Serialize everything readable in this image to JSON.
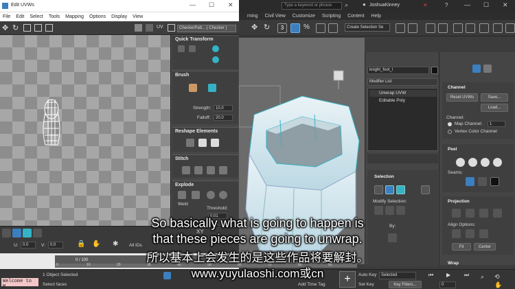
{
  "uvw_window": {
    "title": "Edit UVWs",
    "menu": [
      "File",
      "Edit",
      "Select",
      "Tools",
      "Mapping",
      "Options",
      "Display",
      "View"
    ],
    "uv_label": "UV",
    "checker_dropdown": "CheckerPatt... ( Checker )",
    "sections": {
      "quick_transform": "Quick Transform",
      "brush": "Brush",
      "reshape": "Reshape Elements",
      "stitch": "Stitch",
      "explode": "Explode"
    },
    "strength_label": "Strength:",
    "strength_value": "10.0",
    "falloff_label": "Falloff:",
    "falloff_value": "20.0",
    "weld_label": "Weld",
    "threshold_label": "Threshold:",
    "threshold_value": "0.01",
    "u_label": "U:",
    "u_value": "0.0",
    "v_label": "V:",
    "v_value": "0.0",
    "all_ids": "All IDs",
    "xy_label": "XY"
  },
  "max_window": {
    "search_placeholder": "Type a keyword or phrase",
    "user": "JoshuaKinney",
    "menu": [
      "rning",
      "Civil View",
      "Customize",
      "Scripting",
      "Content",
      "Help"
    ],
    "create_selection_set": "Create Selection Se",
    "object_name": "knight_foot_l",
    "modifier_list": "Modifier List",
    "stack": [
      "Unwrap UVW",
      "Editable Poly"
    ],
    "channel_header": "Channel",
    "reset_uvws": "Reset UVWs",
    "save": "Save...",
    "load": "Load...",
    "channel_label": "Channel:",
    "map_channel_label": "Map Channel:",
    "map_channel_value": "1",
    "vertex_color_channel": "Vertex Color Channel",
    "peel_header": "Peel",
    "seams_label": "Seams:",
    "selection_header": "Selection",
    "modify_selection": "Modify Selection:",
    "by_label": "By:",
    "projection_header": "Projection",
    "align_options": "Align Options:",
    "fit": "Fit",
    "center": "Center",
    "wrap_header": "Wrap"
  },
  "status": {
    "maxscript": "Welcome to M",
    "objects_selected": "1 Object Selected",
    "prompt": "Select faces",
    "add_time_tag": "Add Time Tag",
    "auto_key": "Auto Key",
    "set_key": "Set Key",
    "selected": "Selected",
    "key_filters": "Key Filters...",
    "frame_count": "0 / 100",
    "frame_value": "0"
  },
  "timeline_ticks": [
    "0",
    "10",
    "20",
    "30",
    "40",
    "50",
    "60",
    "70",
    "80",
    "90"
  ],
  "subtitles": {
    "line1": "So basically what is going to happen is",
    "line2": "that these pieces are going to unwrap.",
    "line3": "所以基本上会发生的是这些作品将要解封。",
    "line4": "www.yuyulaoshi.com或cn"
  },
  "colors": {
    "accent_blue": "#3b7fbf",
    "selection_cyan": "#34b3c6",
    "maxscript_bg": "#f3c6c8"
  }
}
